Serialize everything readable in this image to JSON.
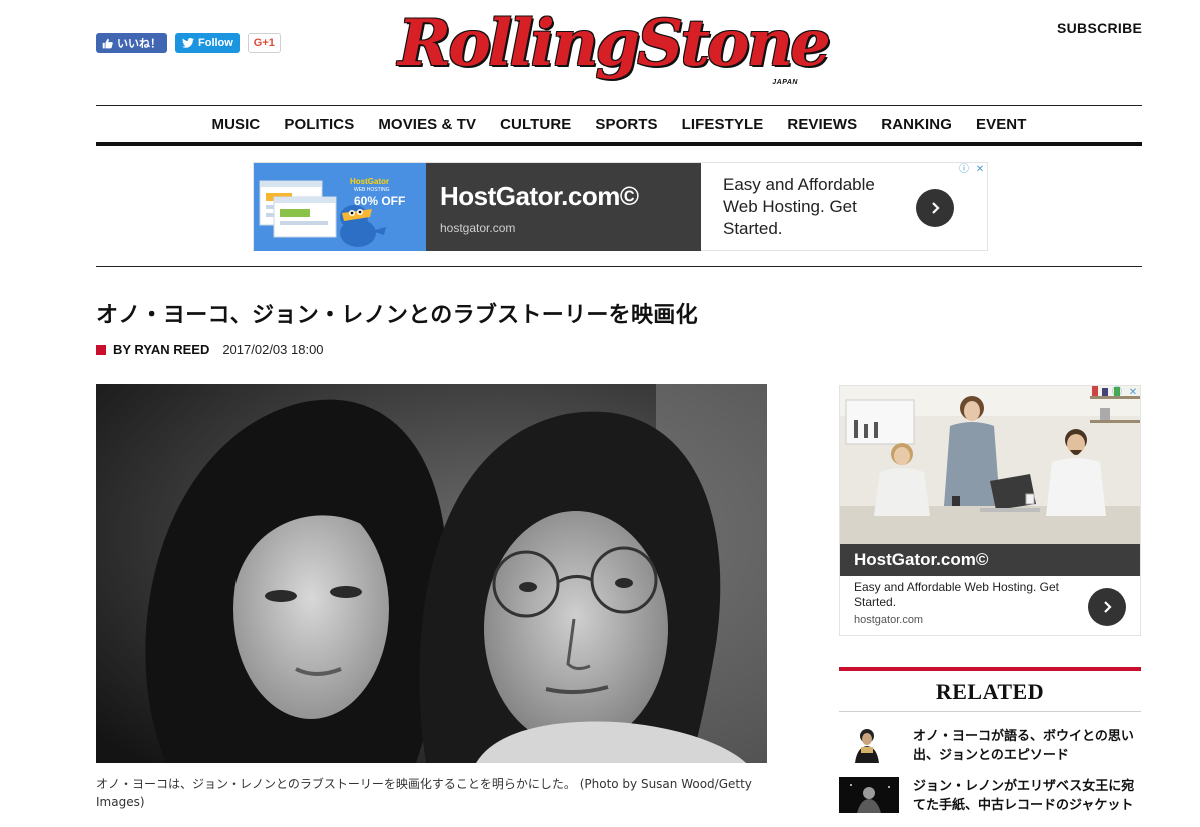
{
  "header": {
    "social": {
      "like_label": "いいね！",
      "follow_label": "Follow",
      "gplus_label": "G+1"
    },
    "logo_text": "RollingStone",
    "logo_sub": "JAPAN",
    "subscribe_label": "SUBSCRIBE"
  },
  "nav": {
    "items": [
      "MUSIC",
      "POLITICS",
      "MOVIES & TV",
      "CULTURE",
      "SPORTS",
      "LIFESTYLE",
      "REVIEWS",
      "RANKING",
      "EVENT"
    ]
  },
  "ad_top": {
    "art_brand": "HostGator",
    "art_sub": "WEB HOSTING",
    "art_offer": "60% OFF",
    "brand": "HostGator.com©",
    "url": "hostgator.com",
    "copy": "Easy and Affordable Web Hosting. Get Started."
  },
  "article": {
    "headline": "オノ・ヨーコ、ジョン・レノンとのラブストーリーを映画化",
    "author": "BY RYAN REED",
    "date": "2017/02/03 18:00",
    "caption": "オノ・ヨーコは、ジョン・レノンとのラブストーリーを映画化することを明らかにした。 (Photo by Susan Wood/Getty Images)"
  },
  "ad_side": {
    "brand": "HostGator.com©",
    "copy": "Easy and Affordable Web Hosting. Get Started.",
    "url": "hostgator.com"
  },
  "related": {
    "title": "RELATED",
    "items": [
      "オノ・ヨーコが語る、ボウイとの思い出、ジョンとのエピソード",
      "ジョン・レノンがエリザベス女王に宛てた手紙、中古レコードのジャケット"
    ]
  },
  "colors": {
    "brand_red": "#d71f26",
    "accent_red": "#c8102e",
    "facebook_blue": "#4267b2",
    "twitter_blue": "#1b95e0",
    "ad_dark": "#3d3d3d"
  }
}
